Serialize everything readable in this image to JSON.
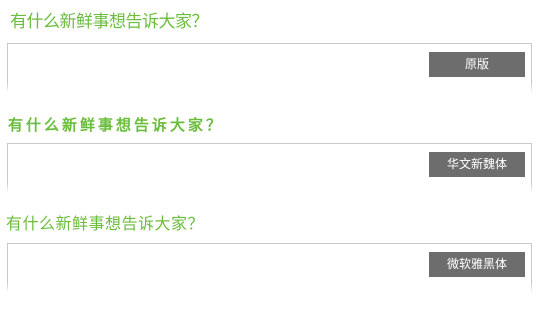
{
  "sections": [
    {
      "heading": "有什么新鲜事想告诉大家？",
      "button_label": "原版"
    },
    {
      "heading": "有什么新鲜事想告诉大家？",
      "button_label": "华文新魏体"
    },
    {
      "heading": "有什么新鲜事想告诉大家？",
      "button_label": "微软雅黑体"
    }
  ],
  "colors": {
    "heading": "#6bbd3e",
    "button_bg": "#6d6d6d",
    "button_text": "#ffffff",
    "border": "#c9c9c9"
  }
}
